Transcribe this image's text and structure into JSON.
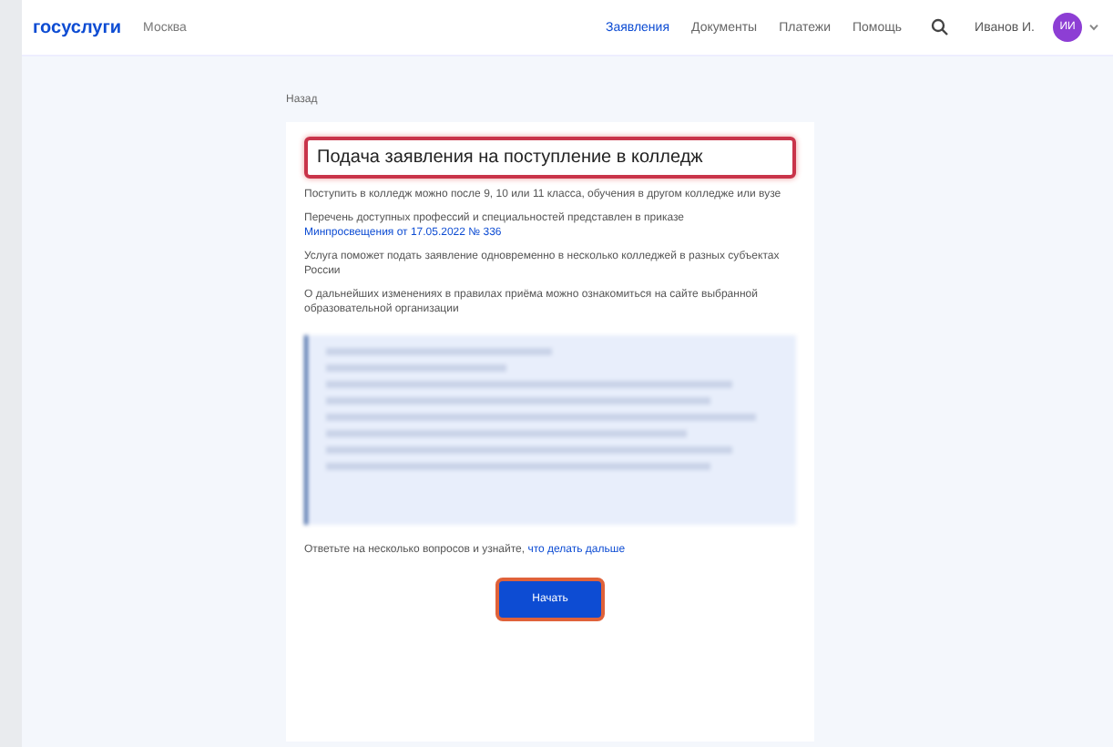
{
  "header": {
    "logo": "госуслуги",
    "region": "Москва",
    "nav": [
      {
        "label": "Заявления",
        "selected": true
      },
      {
        "label": "Документы",
        "selected": false
      },
      {
        "label": "Платежи",
        "selected": false
      },
      {
        "label": "Помощь",
        "selected": false
      }
    ],
    "user": "Иванов И.",
    "avatar": "ИИ"
  },
  "back": "Назад",
  "card": {
    "title": "Подача заявления на поступление в колледж",
    "paragraphs": [
      {
        "text": "Поступить в колледж можно после 9, 10 или 11 класса, обучения в другом колледже или вузе"
      },
      {
        "text": "Перечень доступных профессий и специальностей представлен в приказе",
        "link": "Минпросвещения от 17.05.2022 № 336"
      },
      {
        "text": "Услуга поможет подать заявление одновременно в несколько колледжей в разных субъектах России"
      },
      {
        "text": "О дальнейших изменениях в правилах приёма можно ознакомиться на сайте выбранной образовательной организации"
      }
    ],
    "footer": {
      "text": "Ответьте на несколько вопросов и узнайте,",
      "link": "что делать дальше"
    },
    "button": "Начать"
  }
}
